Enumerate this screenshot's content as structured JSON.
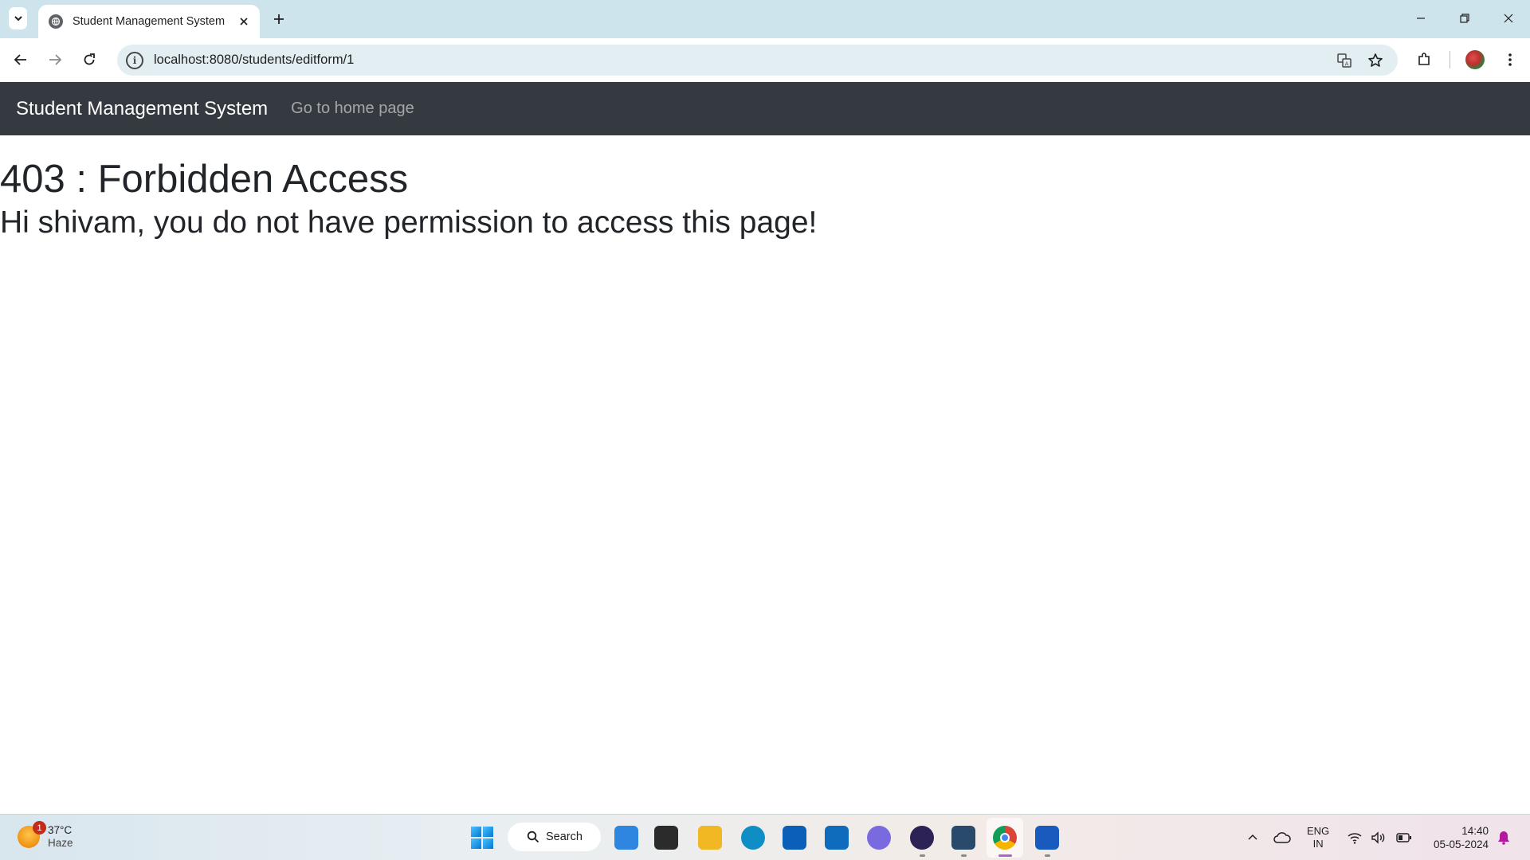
{
  "browser": {
    "tab_title": "Student Management System",
    "url": "localhost:8080/students/editform/1"
  },
  "page": {
    "navbar": {
      "brand": "Student Management System",
      "link": "Go to home page"
    },
    "heading": "403 : Forbidden Access",
    "message": "Hi shivam, you do not have permission to access this page!"
  },
  "taskbar": {
    "weather": {
      "temperature": "37°C",
      "condition": "Haze",
      "badge": "1"
    },
    "search_label": "Search",
    "pinned_apps": [
      {
        "name": "copilot-icon",
        "color": "#2f86e0"
      },
      {
        "name": "task-view-icon",
        "color": "#2b2b2b"
      },
      {
        "name": "file-explorer-icon",
        "color": "#f2b824"
      },
      {
        "name": "edge-icon",
        "color": "#0f8ec5"
      },
      {
        "name": "microsoft-store-icon",
        "color": "#0c5fb8"
      },
      {
        "name": "outlook-icon",
        "color": "#0f6cbd"
      },
      {
        "name": "ms-copilot-app-icon",
        "color": "#7a6ae0"
      },
      {
        "name": "eclipse-icon",
        "color": "#2c2255"
      },
      {
        "name": "mysql-workbench-icon",
        "color": "#2a4a6b"
      },
      {
        "name": "chrome-icon",
        "color": "#db4437"
      },
      {
        "name": "word-icon",
        "color": "#185abd"
      }
    ],
    "tray": {
      "language": "ENG",
      "region": "IN",
      "time": "14:40",
      "date": "05-05-2024"
    }
  }
}
